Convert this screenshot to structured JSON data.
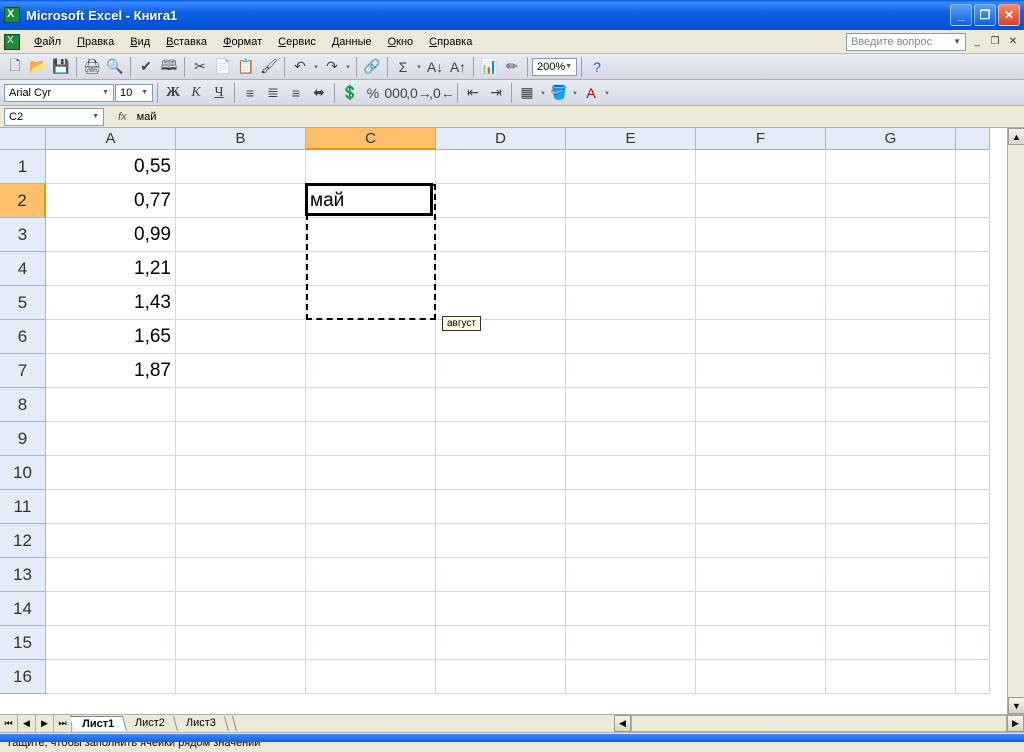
{
  "title": "Microsoft Excel - Книга1",
  "menu": [
    "Файл",
    "Правка",
    "Вид",
    "Вставка",
    "Формат",
    "Сервис",
    "Данные",
    "Окно",
    "Справка"
  ],
  "question_placeholder": "Введите вопрос",
  "font_name": "Arial Cyr",
  "font_size": "10",
  "zoom": "200%",
  "name_box": "C2",
  "fx_label": "fx",
  "formula_value": "май",
  "columns": [
    "A",
    "B",
    "C",
    "D",
    "E",
    "F",
    "G"
  ],
  "active_col_index": 2,
  "rows": [
    "1",
    "2",
    "3",
    "4",
    "5",
    "6",
    "7",
    "8",
    "9",
    "10",
    "11",
    "12",
    "13",
    "14",
    "15",
    "16"
  ],
  "active_row_index": 1,
  "col_A_values": [
    "0,55",
    "0,77",
    "0,99",
    "1,21",
    "1,43",
    "1,65",
    "1,87"
  ],
  "c2_value": "май",
  "tooltip": "август",
  "sheets": [
    "Лист1",
    "Лист2",
    "Лист3"
  ],
  "active_sheet": 0,
  "status": "Тащите, чтобы заполнить ячейки рядом значений",
  "fmt_labels": {
    "bold": "Ж",
    "italic": "К",
    "underline": "Ч"
  }
}
